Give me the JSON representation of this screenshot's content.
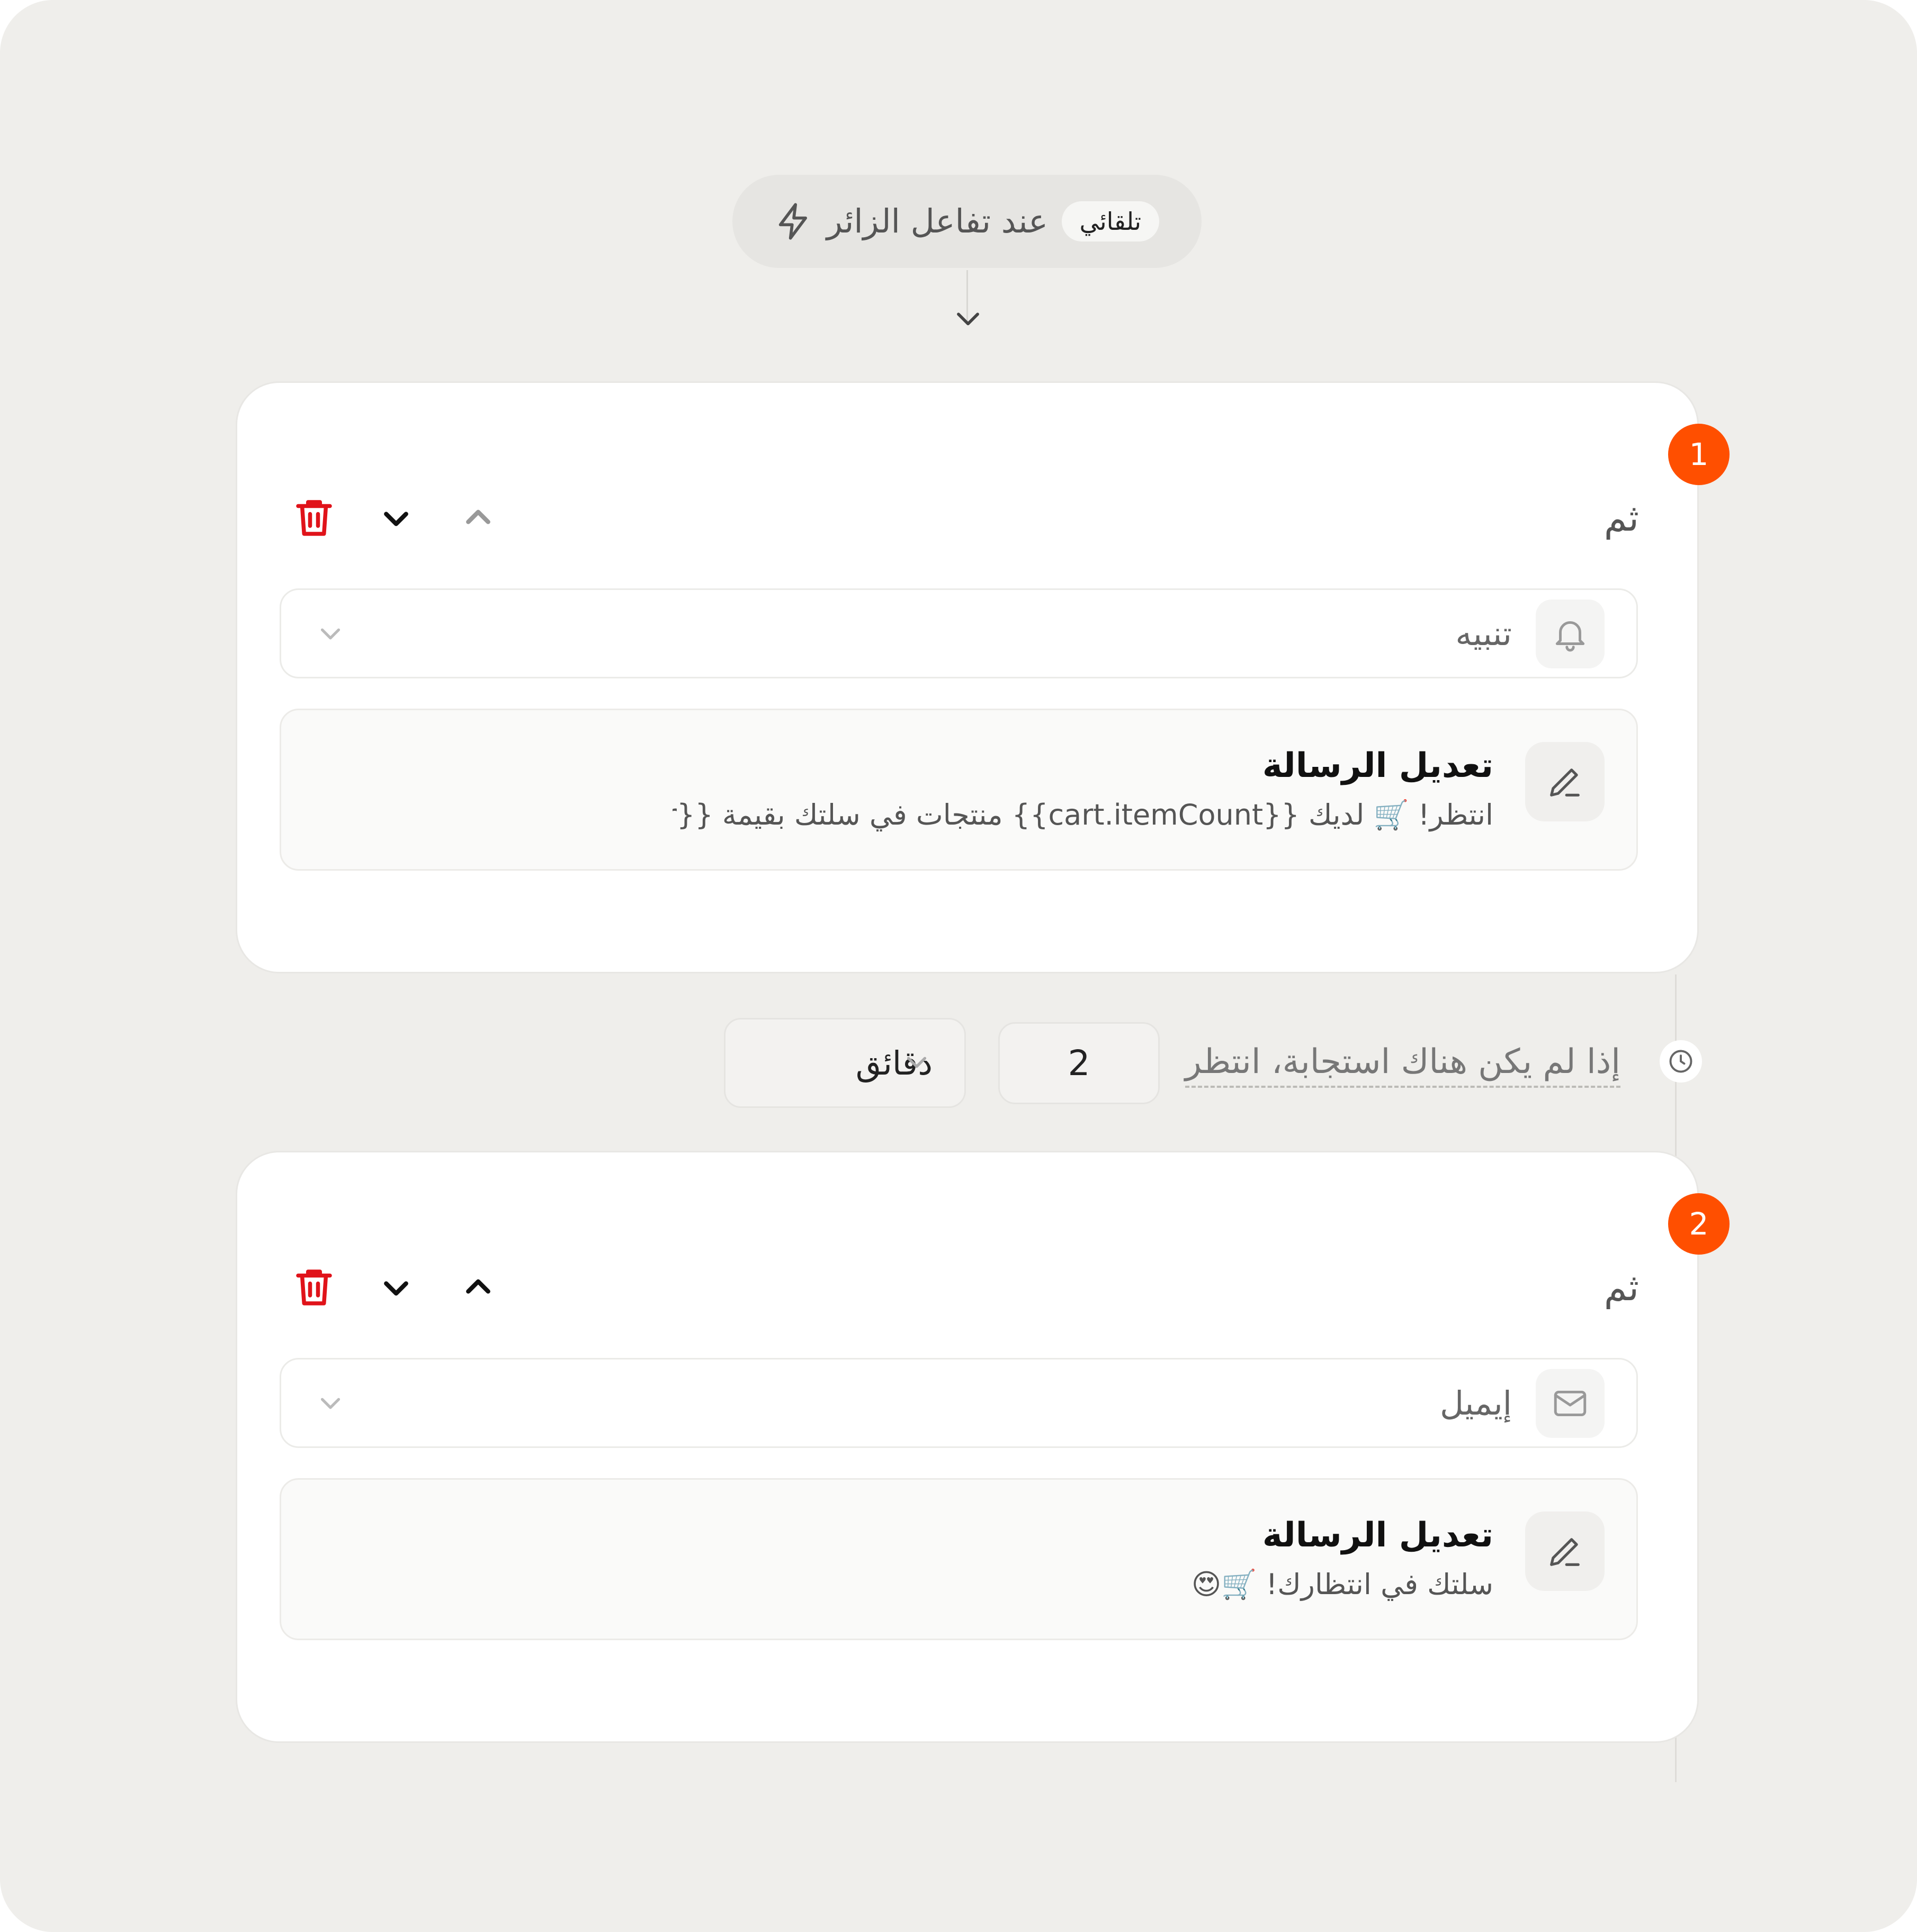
{
  "trigger": {
    "badge": "تلقائي",
    "label": "عند تفاعل الزائر",
    "icon": "bolt-icon"
  },
  "steps": [
    {
      "number": "1",
      "then_label": "ثم",
      "channel": "تنبيه",
      "channel_icon": "bell-icon",
      "message_title": "تعديل الرسالة",
      "message_body": "انتظر! 🛒 لديك {{cart.itemCount}} منتجات في سلتك بقيمة {{car"
    },
    {
      "number": "2",
      "then_label": "ثم",
      "channel": "إيميل",
      "channel_icon": "mail-icon",
      "message_title": "تعديل الرسالة",
      "message_body": "سلتك في انتظارك! 🛒😍"
    }
  ],
  "wait": {
    "label": "إذا لم يكن هناك استجابة، انتظر",
    "amount": "2",
    "unit": "دقائق"
  },
  "colors": {
    "accent": "#ff4f00",
    "delete": "#e0131a",
    "background": "#efeeeb"
  }
}
